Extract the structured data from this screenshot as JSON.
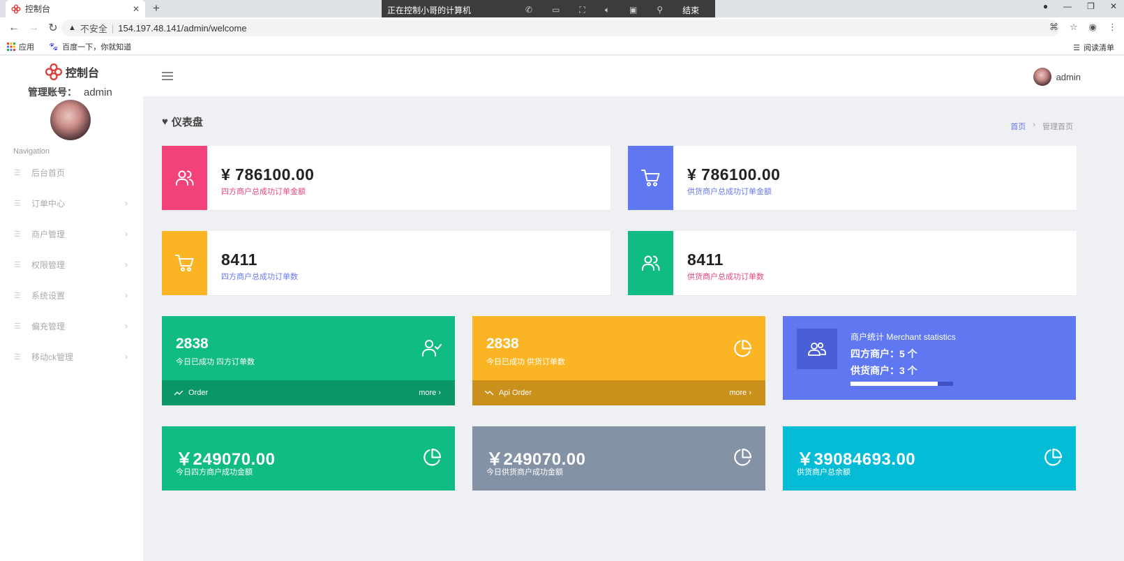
{
  "browser": {
    "tab_title": "控制台",
    "remote_title": "正在控制小哥的计算机",
    "remote_end": "结束",
    "address_warning": "不安全",
    "url": "154.197.48.141/admin/welcome",
    "bookmarks": [
      "应用",
      "百度一下，你就知道"
    ],
    "reading_list": "阅读清单"
  },
  "sidebar": {
    "logo": "控制台",
    "account_label": "管理账号：",
    "account_name": "admin",
    "nav_label": "Navigation",
    "items": [
      {
        "label": "后台首页",
        "has_arrow": false
      },
      {
        "label": "订单中心",
        "has_arrow": true
      },
      {
        "label": "商户管理",
        "has_arrow": true
      },
      {
        "label": "权限管理",
        "has_arrow": true
      },
      {
        "label": "系统设置",
        "has_arrow": true
      },
      {
        "label": "偏充管理",
        "has_arrow": true
      },
      {
        "label": "移动ck管理",
        "has_arrow": true
      }
    ]
  },
  "topbar": {
    "user": "admin"
  },
  "page": {
    "title": "仪表盘",
    "breadcrumb": [
      "首页",
      "管理首页"
    ]
  },
  "colors": {
    "pink": "#f3417a",
    "blue": "#5f77f1",
    "amber": "#fbb524",
    "green": "#10bc83",
    "slate": "#8492a6",
    "cyan": "#05bcd6"
  },
  "stats_wide": [
    {
      "value": "¥ 786100.00",
      "label": "四方商户总成功订单金额",
      "icon": "users-icon",
      "color": "#f3417a",
      "label_color": "#e5457a"
    },
    {
      "value": "¥ 786100.00",
      "label": "供货商户总成功订单金额",
      "icon": "cart-icon",
      "color": "#5f77f1",
      "label_color": "#6777ef"
    },
    {
      "value": "8411",
      "label": "四方商户总成功订单数",
      "icon": "cart-icon",
      "color": "#fbb524",
      "label_color": "#6777ef"
    },
    {
      "value": "8411",
      "label": "供货商户总成功订单数",
      "icon": "users-icon",
      "color": "#10bc83",
      "label_color": "#e5457a"
    }
  ],
  "cards_mid": [
    {
      "value": "2838",
      "label": "今日已成功 四方订单数",
      "footer": "Order",
      "more": "more",
      "icon": "user-check-icon",
      "color": "#10bc83",
      "footer_color": "#0b9667"
    },
    {
      "value": "2838",
      "label": "今日已成功 供货订单数",
      "footer": "Api Order",
      "more": "more",
      "icon": "pie-chart-icon",
      "color": "#fbb524",
      "footer_color": "#c9901b"
    }
  ],
  "merchant": {
    "title": "商户统计 Merchant statistics",
    "line1": "四方商户：5 个",
    "line2": "供货商户：3 个",
    "progress": 0.85
  },
  "cards_bottom": [
    {
      "value": "￥249070.00",
      "label": "今日四方商户成功金额",
      "color": "#10bc83"
    },
    {
      "value": "￥249070.00",
      "label": "今日供货商户成功金额",
      "color": "#8492a6"
    },
    {
      "value": "￥39084693.00",
      "label": "供货商户总余额",
      "color": "#05bcd6"
    }
  ]
}
